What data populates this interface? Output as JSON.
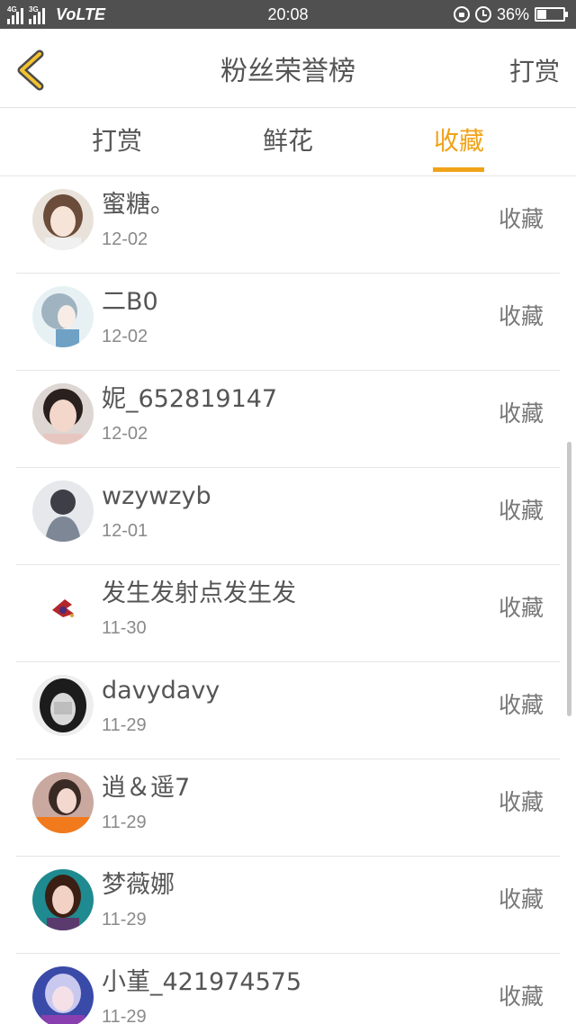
{
  "status_bar": {
    "network_1": "4G",
    "network_2": "3G",
    "volte": "VoLTE",
    "time": "20:08",
    "battery": "36%",
    "battery_level": 0.36,
    "icons": [
      "rotation-lock-icon",
      "alarm-icon",
      "battery-icon"
    ]
  },
  "header": {
    "title": "粉丝荣誉榜",
    "action": "打赏",
    "back_icon": "chevron-left-icon",
    "accent_color": "#f0a318"
  },
  "tabs": [
    {
      "label": "打赏",
      "active": false
    },
    {
      "label": "鲜花",
      "active": false
    },
    {
      "label": "收藏",
      "active": true
    }
  ],
  "list": [
    {
      "name": "蜜糖。",
      "date": "12-02",
      "action": "收藏"
    },
    {
      "name": "二B0",
      "date": "12-02",
      "action": "收藏"
    },
    {
      "name": "妮_652819147",
      "date": "12-02",
      "action": "收藏"
    },
    {
      "name": "wzywzyb",
      "date": "12-01",
      "action": "收藏"
    },
    {
      "name": "发生发射点发生发",
      "date": "11-30",
      "action": "收藏"
    },
    {
      "name": "davydavy",
      "date": "11-29",
      "action": "收藏"
    },
    {
      "name": "逍＆遥7",
      "date": "11-29",
      "action": "收藏"
    },
    {
      "name": "梦薇娜",
      "date": "11-29",
      "action": "收藏"
    },
    {
      "name": "小堇_421974575",
      "date": "11-29",
      "action": "收藏"
    }
  ]
}
